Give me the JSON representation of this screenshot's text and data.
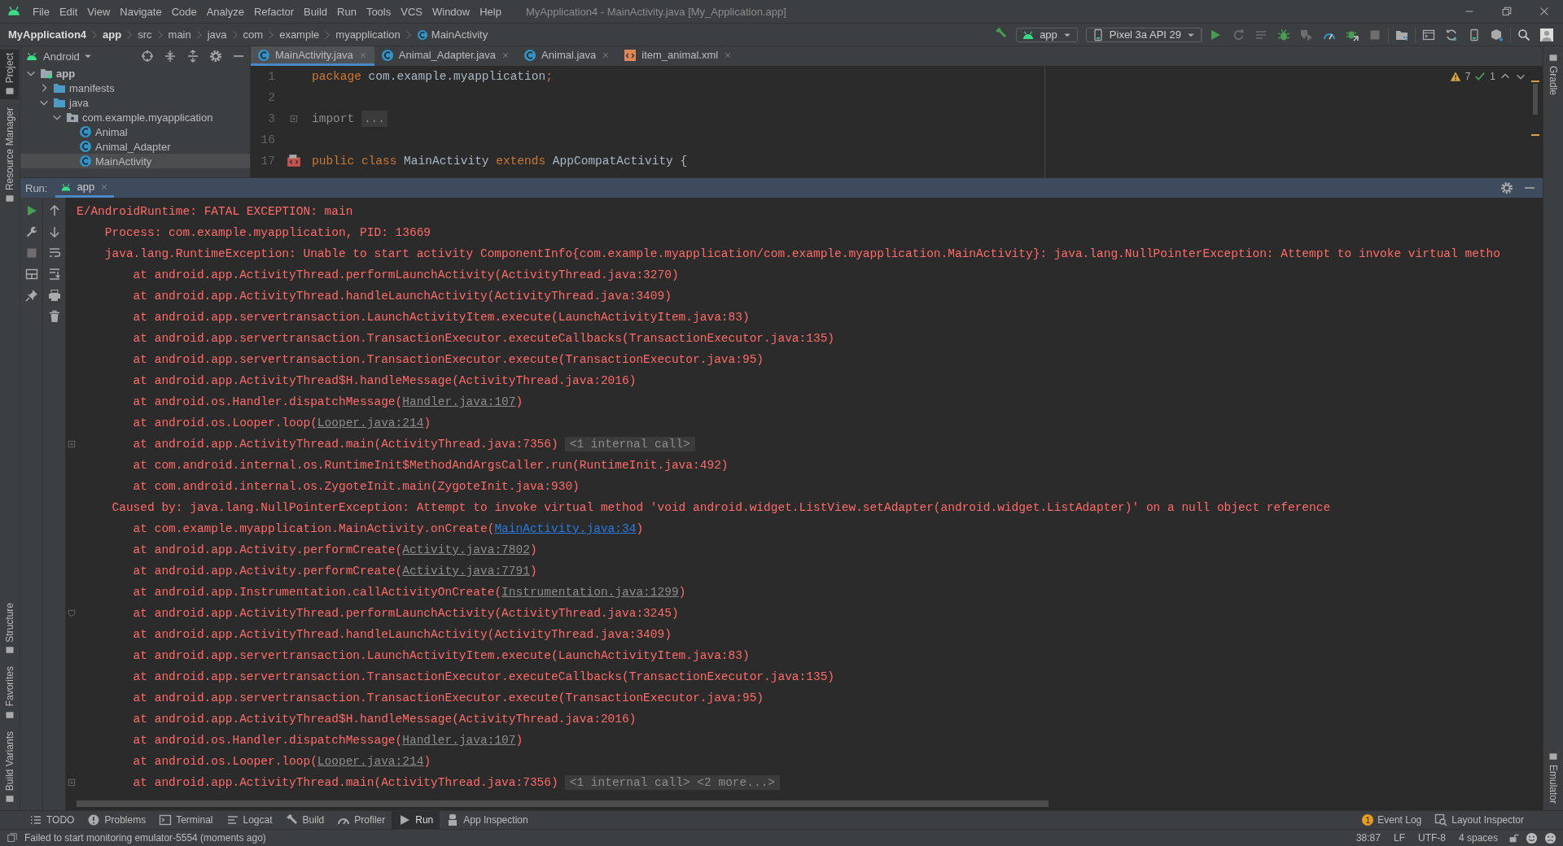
{
  "menu_bar": {
    "menus": [
      "File",
      "Edit",
      "View",
      "Navigate",
      "Code",
      "Analyze",
      "Refactor",
      "Build",
      "Run",
      "Tools",
      "VCS",
      "Window",
      "Help"
    ],
    "title": "MyApplication4 - MainActivity.java [My_Application.app]"
  },
  "nav_bar": {
    "breadcrumbs": [
      {
        "label": "MyApplication4",
        "bold": true,
        "kind": "text"
      },
      {
        "label": "app",
        "bold": true,
        "kind": "text"
      },
      {
        "label": "src",
        "bold": false,
        "kind": "text"
      },
      {
        "label": "main",
        "bold": false,
        "kind": "text"
      },
      {
        "label": "java",
        "bold": false,
        "kind": "text"
      },
      {
        "label": "com",
        "bold": false,
        "kind": "text"
      },
      {
        "label": "example",
        "bold": false,
        "kind": "text"
      },
      {
        "label": "myapplication",
        "bold": false,
        "kind": "text"
      },
      {
        "label": "MainActivity",
        "bold": false,
        "kind": "class"
      }
    ],
    "config": "app",
    "device": "Pixel 3a API 29",
    "actions": [
      [
        {
          "kind": "run",
          "disabled": false
        },
        {
          "kind": "rerun",
          "disabled": true
        },
        {
          "kind": "apply",
          "disabled": true
        },
        {
          "kind": "debug",
          "disabled": false
        },
        {
          "kind": "profile",
          "disabled": true
        },
        {
          "kind": "gauge",
          "disabled": false
        },
        {
          "kind": "attach",
          "disabled": false
        },
        {
          "kind": "stop",
          "disabled": true
        }
      ],
      [
        {
          "kind": "structure",
          "disabled": false
        }
      ],
      [
        {
          "kind": "window",
          "disabled": false
        },
        {
          "kind": "sync",
          "disabled": false
        },
        {
          "kind": "phone",
          "disabled": false
        },
        {
          "kind": "cube",
          "disabled": false
        }
      ],
      [
        {
          "kind": "search",
          "disabled": false
        },
        {
          "kind": "avatar",
          "disabled": false
        }
      ]
    ]
  },
  "left_strip": {
    "top": [
      {
        "label": "Project",
        "selected": true
      },
      {
        "label": "Resource Manager",
        "selected": false
      }
    ],
    "bottom": [
      {
        "label": "Structure",
        "selected": false
      },
      {
        "label": "Favorites",
        "selected": false
      },
      {
        "label": "Build Variants",
        "selected": false
      }
    ]
  },
  "right_strip": {
    "top": [
      {
        "label": "Gradle",
        "selected": false
      }
    ],
    "bottom": [
      {
        "label": "Emulator",
        "selected": false
      }
    ]
  },
  "project": {
    "view": "Android",
    "tree": [
      {
        "label": "app",
        "kind": "module",
        "expanded": true,
        "selected": false,
        "children": [
          {
            "label": "manifests",
            "kind": "folder",
            "expanded": false,
            "selected": false
          },
          {
            "label": "java",
            "kind": "folder",
            "expanded": true,
            "selected": false,
            "children": [
              {
                "label": "com.example.myapplication",
                "kind": "package",
                "expanded": true,
                "selected": false,
                "children": [
                  {
                    "label": "Animal",
                    "kind": "class",
                    "selected": false
                  },
                  {
                    "label": "Animal_Adapter",
                    "kind": "class",
                    "selected": false
                  },
                  {
                    "label": "MainActivity",
                    "kind": "class",
                    "selected": true
                  }
                ]
              }
            ]
          }
        ]
      }
    ]
  },
  "editor": {
    "tabs": [
      {
        "label": "MainActivity.java",
        "kind": "class",
        "selected": true
      },
      {
        "label": "Animal_Adapter.java",
        "kind": "class",
        "selected": false
      },
      {
        "label": "Animal.java",
        "kind": "class",
        "selected": false
      },
      {
        "label": "item_animal.xml",
        "kind": "xml",
        "selected": false
      }
    ],
    "warnings": "7",
    "passed": "1",
    "lines": [
      {
        "number": "1",
        "tokens": [
          {
            "text": "package",
            "kind": "keyword"
          },
          {
            "text": " com.example.myapplication",
            "kind": "plain"
          },
          {
            "text": ";",
            "kind": "keyword"
          }
        ]
      },
      {
        "number": "2"
      },
      {
        "number": "3",
        "fold": {
          "kind": "expand"
        },
        "tokens": [
          {
            "text": "import ",
            "kind": "muted"
          },
          {
            "text": "...",
            "kind": "chip"
          }
        ]
      },
      {
        "number": "16"
      },
      {
        "number": "17",
        "gutter": {
          "kind": "layout"
        },
        "tokens": [
          {
            "text": "public class",
            "kind": "keyword"
          },
          {
            "text": " MainActivity ",
            "kind": "plain"
          },
          {
            "text": "extends",
            "kind": "keyword"
          },
          {
            "text": " AppCompatActivity {",
            "kind": "plain"
          }
        ]
      }
    ]
  },
  "run": {
    "label": "Run:",
    "tabs": [
      {
        "label": "app",
        "selected": true
      }
    ],
    "toolbar": [
      [
        {
          "kind": "run",
          "disabled": false
        },
        {
          "kind": "wrench",
          "disabled": false
        },
        {
          "kind": "stop",
          "disabled": true
        },
        {
          "kind": "layout",
          "disabled": false
        },
        {
          "kind": "pin",
          "disabled": false
        }
      ],
      [
        {
          "kind": "up",
          "disabled": false
        },
        {
          "kind": "down",
          "disabled": false
        },
        {
          "kind": "wrap",
          "disabled": false
        },
        {
          "kind": "scroll",
          "disabled": false
        },
        {
          "kind": "print",
          "disabled": false
        },
        {
          "kind": "trash",
          "disabled": false
        }
      ]
    ],
    "console": [
      {
        "kind": "header",
        "text": "E/AndroidRuntime: FATAL EXCEPTION: main"
      },
      {
        "kind": "process",
        "text": "Process: com.example.myapplication, PID: 13669"
      },
      {
        "kind": "exception",
        "text": "java.lang.RuntimeException: Unable to start activity ComponentInfo{com.example.myapplication/com.example.myapplication.MainActivity}: java.lang.NullPointerException: Attempt to invoke virtual metho"
      },
      {
        "kind": "frame",
        "text": "at android.app.ActivityThread.performLaunchActivity(ActivityThread.java:3270)"
      },
      {
        "kind": "frame",
        "text": "at android.app.ActivityThread.handleLaunchActivity(ActivityThread.java:3409)"
      },
      {
        "kind": "frame",
        "text": "at android.app.servertransaction.LaunchActivityItem.execute(LaunchActivityItem.java:83)"
      },
      {
        "kind": "frame",
        "text": "at android.app.servertransaction.TransactionExecutor.executeCallbacks(TransactionExecutor.java:135)"
      },
      {
        "kind": "frame",
        "text": "at android.app.servertransaction.TransactionExecutor.execute(TransactionExecutor.java:95)"
      },
      {
        "kind": "frame",
        "text": "at android.app.ActivityThread$H.handleMessage(ActivityThread.java:2016)"
      },
      {
        "kind": "frame",
        "text": "at android.os.Handler.dispatchMessage(",
        "link": {
          "text": "Handler.java:107",
          "kind": "library"
        },
        "after": ")"
      },
      {
        "kind": "frame",
        "text": "at android.os.Looper.loop(",
        "link": {
          "text": "Looper.java:214",
          "kind": "library"
        },
        "after": ")"
      },
      {
        "kind": "frame",
        "text": "at android.app.ActivityThread.main(ActivityThread.java:7356)",
        "folded": "<1 internal call>",
        "fold": {
          "kind": "expand"
        }
      },
      {
        "kind": "frame",
        "text": "at com.android.internal.os.RuntimeInit$MethodAndArgsCaller.run(RuntimeInit.java:492)"
      },
      {
        "kind": "frame",
        "text": "at com.android.internal.os.ZygoteInit.main(ZygoteInit.java:930)"
      },
      {
        "kind": "caused",
        "text": "Caused by: java.lang.NullPointerException: Attempt to invoke virtual method 'void android.widget.ListView.setAdapter(android.widget.ListAdapter)' on a null object reference"
      },
      {
        "kind": "frame",
        "text": "at com.example.myapplication.MainActivity.onCreate(",
        "link": {
          "text": "MainActivity.java:34",
          "kind": "project"
        },
        "after": ")"
      },
      {
        "kind": "frame",
        "text": "at android.app.Activity.performCreate(",
        "link": {
          "text": "Activity.java:7802",
          "kind": "library"
        },
        "after": ")"
      },
      {
        "kind": "frame",
        "text": "at android.app.Activity.performCreate(",
        "link": {
          "text": "Activity.java:7791",
          "kind": "library"
        },
        "after": ")"
      },
      {
        "kind": "frame",
        "text": "at android.app.Instrumentation.callActivityOnCreate(",
        "link": {
          "text": "Instrumentation.java:1299",
          "kind": "library"
        },
        "after": ")"
      },
      {
        "kind": "frame",
        "text": "at android.app.ActivityThread.performLaunchActivity(ActivityThread.java:3245)",
        "fold": {
          "kind": "collapse"
        }
      },
      {
        "kind": "frame",
        "text": "at android.app.ActivityThread.handleLaunchActivity(ActivityThread.java:3409)"
      },
      {
        "kind": "frame",
        "text": "at android.app.servertransaction.LaunchActivityItem.execute(LaunchActivityItem.java:83)"
      },
      {
        "kind": "frame",
        "text": "at android.app.servertransaction.TransactionExecutor.executeCallbacks(TransactionExecutor.java:135)"
      },
      {
        "kind": "frame",
        "text": "at android.app.servertransaction.TransactionExecutor.execute(TransactionExecutor.java:95)"
      },
      {
        "kind": "frame",
        "text": "at android.app.ActivityThread$H.handleMessage(ActivityThread.java:2016)"
      },
      {
        "kind": "frame",
        "text": "at android.os.Handler.dispatchMessage(",
        "link": {
          "text": "Handler.java:107",
          "kind": "library"
        },
        "after": ")"
      },
      {
        "kind": "frame",
        "text": "at android.os.Looper.loop(",
        "link": {
          "text": "Looper.java:214",
          "kind": "library"
        },
        "after": ")"
      },
      {
        "kind": "frame",
        "text": "at android.app.ActivityThread.main(ActivityThread.java:7356)",
        "folded": "<1 internal call> <2 more...>",
        "fold": {
          "kind": "expand"
        }
      }
    ]
  },
  "bottom_tabs": [
    {
      "label": "TODO",
      "kind": "list",
      "selected": false
    },
    {
      "label": "Problems",
      "kind": "problems",
      "selected": false
    },
    {
      "label": "Terminal",
      "kind": "terminal",
      "selected": false
    },
    {
      "label": "Logcat",
      "kind": "logcat",
      "selected": false
    },
    {
      "label": "Build",
      "kind": "build",
      "selected": false
    },
    {
      "label": "Profiler",
      "kind": "profiler",
      "selected": false
    },
    {
      "label": "Run",
      "kind": "run",
      "selected": true
    },
    {
      "label": "App Inspection",
      "kind": "inspection",
      "selected": false
    }
  ],
  "right_tabs": [
    {
      "label": "Event Log",
      "kind": "event",
      "badge": "1"
    },
    {
      "label": "Layout Inspector",
      "kind": "inspector"
    }
  ],
  "status_bar": {
    "message": "Failed to start monitoring emulator-5554 (moments ago)",
    "items": [
      "38:87",
      "LF",
      "UTF-8",
      "4 spaces"
    ]
  }
}
